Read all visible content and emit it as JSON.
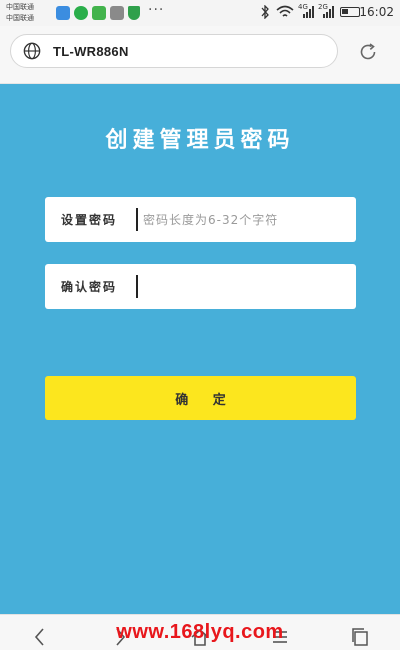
{
  "status_bar": {
    "carrier_1": "中国联通",
    "carrier_2": "中国联通",
    "more": "···",
    "network_1": "4G",
    "network_2": "2G",
    "time": "16:02"
  },
  "address_bar": {
    "url": "TL-WR886N",
    "icons": {
      "site": "globe-icon",
      "reload": "refresh-icon"
    }
  },
  "page": {
    "title": "创建管理员密码",
    "background_color": "#47afd9",
    "set_password": {
      "label": "设置密码",
      "placeholder": "密码长度为6-32个字符",
      "value": ""
    },
    "confirm_password": {
      "label": "确认密码",
      "value": ""
    },
    "confirm_button": {
      "label": "确 定",
      "color": "#fce61e"
    }
  },
  "watermark": "www.168lyq.com",
  "bottom_nav": {
    "icons": [
      "back-icon",
      "forward-icon",
      "home-icon",
      "menu-icon",
      "tabs-icon"
    ]
  }
}
